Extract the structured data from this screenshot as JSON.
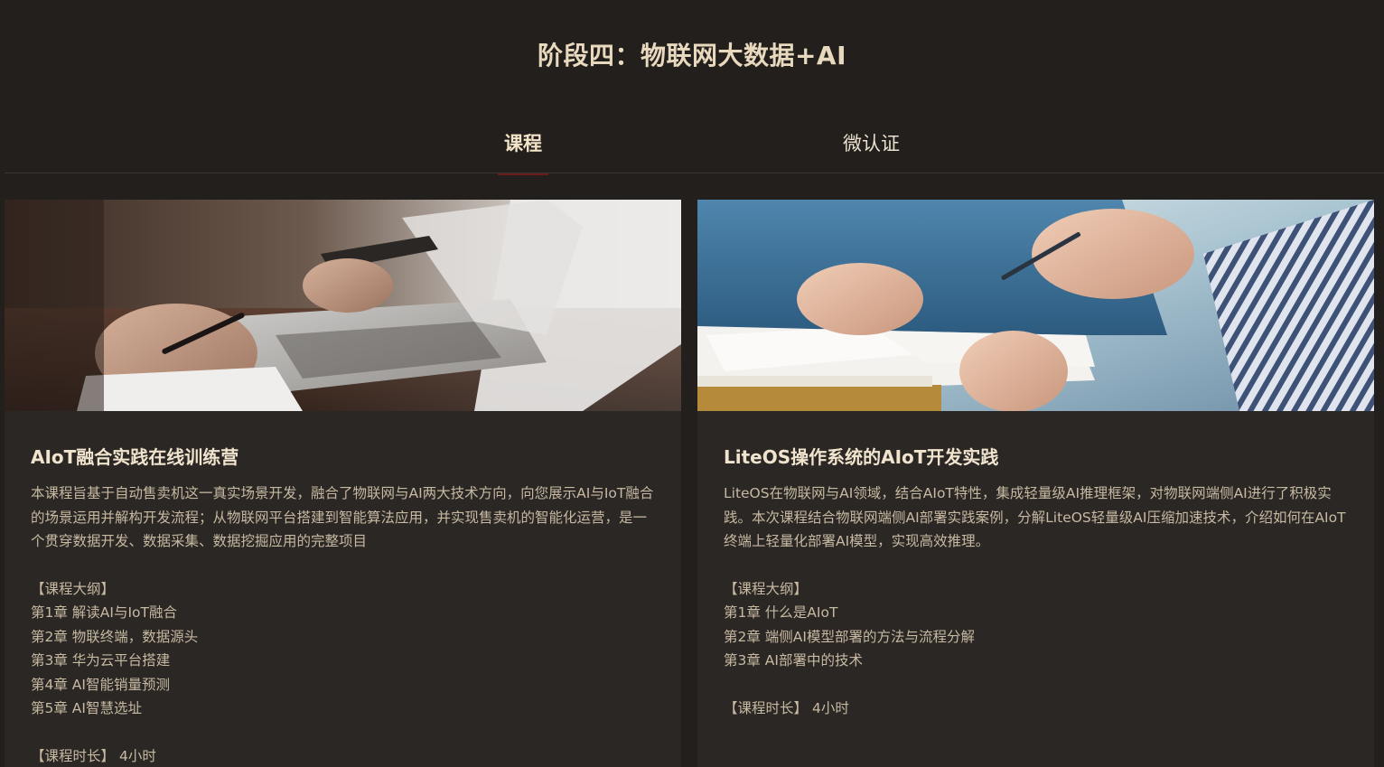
{
  "stage_title": "阶段四：物联网大数据+AI",
  "tabs": [
    {
      "label": "课程",
      "active": true
    },
    {
      "label": "微认证",
      "active": false
    }
  ],
  "courses": [
    {
      "title": "AIoT融合实践在线训练营",
      "description": "本课程旨基于自动售卖机这一真实场景开发，融合了物联网与AI两大技术方向，向您展示AI与IoT融合的场景运用并解构开发流程；从物联网平台搭建到智能算法应用，并实现售卖机的智能化运营，是一个贯穿数据开发、数据采集、数据挖掘应用的完整项目",
      "outline_heading": "【课程大纲】",
      "outline": [
        "第1章 解读AI与IoT融合",
        "第2章 物联终端，数据源头",
        "第3章 华为云平台搭建",
        "第4章 AI智能销量预测",
        "第5章 AI智慧选址"
      ],
      "duration_label": "【课程时长】",
      "duration_value": "4小时"
    },
    {
      "title": "LiteOS操作系统的AIoT开发实践",
      "description": "LiteOS在物联网与AI领域，结合AIoT特性，集成轻量级AI推理框架，对物联网端侧AI进行了积极实践。本次课程结合物联网端侧AI部署实践案例，分解LiteOS轻量级AI压缩加速技术，介绍如何在AIoT终端上轻量化部署AI模型，实现高效推理。",
      "outline_heading": "【课程大纲】",
      "outline": [
        "第1章 什么是AIoT",
        "第2章 端侧AI模型部署的方法与流程分解",
        "第3章 AI部署中的技术"
      ],
      "duration_label": "【课程时长】",
      "duration_value": "4小时"
    }
  ],
  "colors": {
    "background": "#221f1c",
    "card": "#2a2724",
    "title": "#e8d8bd",
    "body_text": "#c7b9a2",
    "tab_underline": "#6b1b1b"
  }
}
